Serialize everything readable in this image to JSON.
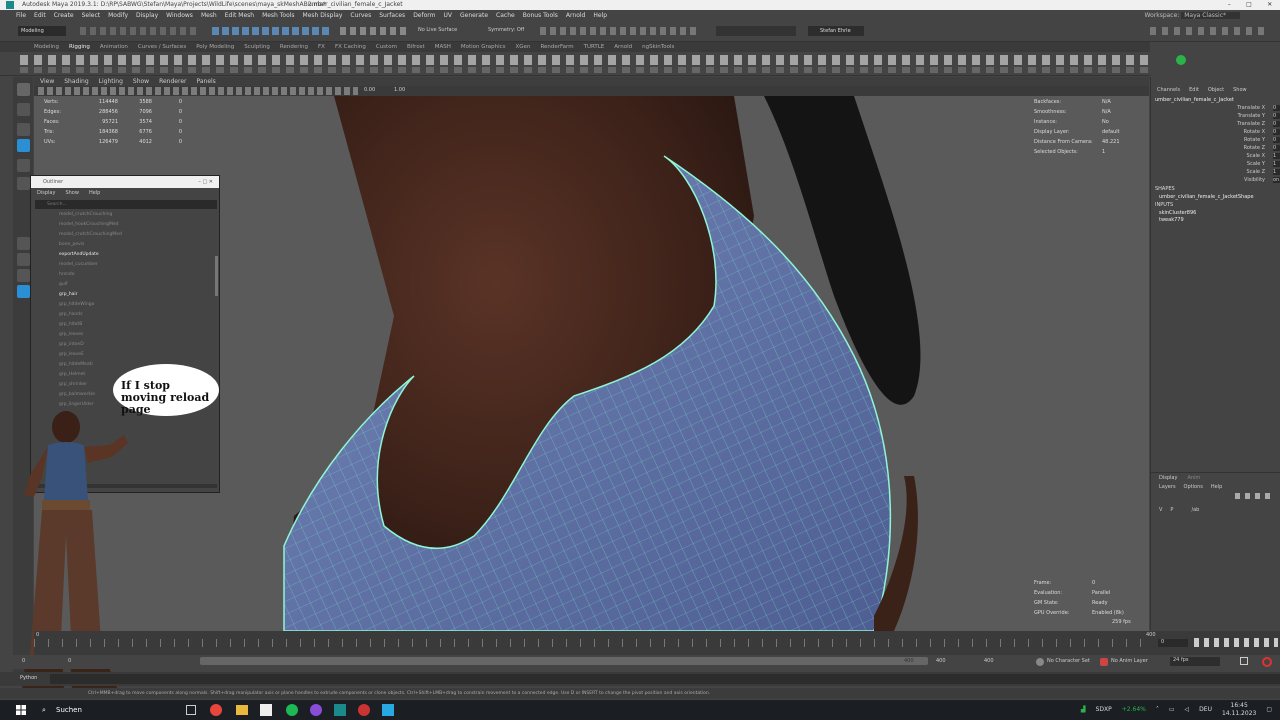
{
  "window": {
    "title": "Autodesk Maya 2019.3.1: D:\\RP\\SABWG\\Stefan\\Maya\\Projects\\WildLife\\scenes\\maya_skMeshAB2.ma*",
    "object": "umber_civilian_female_c_Jacket"
  },
  "menubar": {
    "items": [
      "File",
      "Edit",
      "Create",
      "Select",
      "Modify",
      "Display",
      "Windows",
      "Mesh",
      "Edit Mesh",
      "Mesh Tools",
      "Mesh Display",
      "Curves",
      "Surfaces",
      "Deform",
      "UV",
      "Generate",
      "Cache",
      "Bonus Tools",
      "Arnold",
      "Help"
    ],
    "workspace_label": "Workspace:",
    "workspace_value": "Maya Classic*"
  },
  "statusline": {
    "mode": "Modeling",
    "symmetry": "Symmetry: Off",
    "live_surface": "No Live Surface",
    "user": "Stefan Ehrle"
  },
  "shelf_tabs": [
    "Modeling",
    "Rigging",
    "Animation",
    "Curves / Surfaces",
    "Poly Modeling",
    "Sculpting",
    "Rendering",
    "FX",
    "FX Caching",
    "Custom",
    "Bifrost",
    "MASH",
    "Motion Graphics",
    "XGen",
    "RenderFarm",
    "TURTLE",
    "Arnold",
    "ngSkinTools"
  ],
  "shelf_active": "Rigging",
  "viewport_menu": [
    "View",
    "Shading",
    "Lighting",
    "Show",
    "Renderer",
    "Panels"
  ],
  "viewport_bar": {
    "exposure": "0.00",
    "gamma": "1.00"
  },
  "hud_left": {
    "rows": [
      {
        "label": "Verts:",
        "a": "114448",
        "b": "3588",
        "c": "0"
      },
      {
        "label": "Edges:",
        "a": "288456",
        "b": "7096",
        "c": "0"
      },
      {
        "label": "Faces:",
        "a": "95721",
        "b": "3574",
        "c": "0"
      },
      {
        "label": "Tris:",
        "a": "184368",
        "b": "6776",
        "c": "0"
      },
      {
        "label": "UVs:",
        "a": "126479",
        "b": "4012",
        "c": "0"
      }
    ]
  },
  "hud_right": {
    "rows": [
      {
        "label": "Backfaces:",
        "value": "N/A"
      },
      {
        "label": "Smoothness:",
        "value": "N/A"
      },
      {
        "label": "Instance:",
        "value": "No"
      },
      {
        "label": "Display Layer:",
        "value": "default"
      },
      {
        "label": "Distance From Camera:",
        "value": "48.221"
      },
      {
        "label": "Selected Objects:",
        "value": "1"
      }
    ]
  },
  "hud_bottom_right": {
    "rows": [
      {
        "label": "Frame:",
        "value": "0"
      },
      {
        "label": "Evaluation:",
        "value": "Parallel"
      },
      {
        "label": "GM State:",
        "value": "Ready"
      },
      {
        "label": "GPU Override:",
        "value": "Enabled (8k)"
      }
    ],
    "fps": "259 fps"
  },
  "channel_box": {
    "tabs": [
      "Channels",
      "Edit",
      "Object",
      "Show"
    ],
    "object": "umber_civilian_female_c_Jacket",
    "attributes": [
      {
        "name": "Translate X",
        "value": "0"
      },
      {
        "name": "Translate Y",
        "value": "0"
      },
      {
        "name": "Translate Z",
        "value": "0"
      },
      {
        "name": "Rotate X",
        "value": "0"
      },
      {
        "name": "Rotate Y",
        "value": "0"
      },
      {
        "name": "Rotate Z",
        "value": "0"
      },
      {
        "name": "Scale X",
        "value": "1"
      },
      {
        "name": "Scale Y",
        "value": "1"
      },
      {
        "name": "Scale Z",
        "value": "1"
      },
      {
        "name": "Visibility",
        "value": "on"
      }
    ],
    "shapes_header": "SHAPES",
    "shape_name": "umber_civilian_female_c_JacketShape",
    "inputs_header": "INPUTS",
    "inputs": [
      "skinCluster896",
      "tweak779"
    ]
  },
  "layer_editor": {
    "tabs": [
      "Display",
      "Anim"
    ],
    "menu": [
      "Layers",
      "Options",
      "Help"
    ],
    "row": {
      "v": "V",
      "p": "P",
      "name": "/ab"
    }
  },
  "outliner": {
    "title": "Outliner",
    "menu": [
      "Display",
      "Show",
      "Help"
    ],
    "search_placeholder": "Search...",
    "items": [
      {
        "name": "model_crutchCrouching",
        "hi": false
      },
      {
        "name": "model_hookCrouchingMed",
        "hi": false
      },
      {
        "name": "model_crutchCrouchingMed",
        "hi": false
      },
      {
        "name": "bone_pevis",
        "hi": false
      },
      {
        "name": "exportAndUpdate",
        "hi": true
      },
      {
        "name": "model_cucumber",
        "hi": false
      },
      {
        "name": "hrsndo",
        "hi": false
      },
      {
        "name": "gulf",
        "hi": false
      },
      {
        "name": "grp_hair",
        "hi": true
      },
      {
        "name": "grp_hitdeWingo",
        "hi": false
      },
      {
        "name": "grp_hands",
        "hi": false
      },
      {
        "name": "grp_hitotB",
        "hi": false
      },
      {
        "name": "grp_leaves",
        "hi": false
      },
      {
        "name": "grp_intoeD",
        "hi": false
      },
      {
        "name": "grp_leaveE",
        "hi": false
      },
      {
        "name": "grp_hitdeMeati",
        "hi": false
      },
      {
        "name": "grp_Helmet",
        "hi": false
      },
      {
        "name": "grp_shrinker",
        "hi": false
      },
      {
        "name": "grp_balmworkle",
        "hi": false
      },
      {
        "name": "grp_lingerUlder",
        "hi": false
      }
    ]
  },
  "overlay": {
    "bubble_text": "If I stop moving reload page"
  },
  "timeline": {
    "start": "0",
    "end": "400",
    "current": "0"
  },
  "range": {
    "start": "0",
    "range_start": "0",
    "range_end": "400",
    "end_a": "400",
    "end_b": "400",
    "character_set": "No Character Set",
    "anim_layer": "No Anim Layer",
    "fps": "24 fps"
  },
  "python_label": "Python",
  "help_line": "Ctrl+MMB+drag to move components along normals. Shift+drag manipulator axis or plane handles to extrude components or clone objects. Ctrl+Shift+LMB+drag to constrain movement to a connected edge. Use D or INSERT to change the pivot position and axis orientation.",
  "taskbar": {
    "search": "Suchen",
    "market": "SDXP",
    "market_change": "+2.64%",
    "lang": "DEU",
    "time": "16:45",
    "date": "14.11.2023"
  }
}
